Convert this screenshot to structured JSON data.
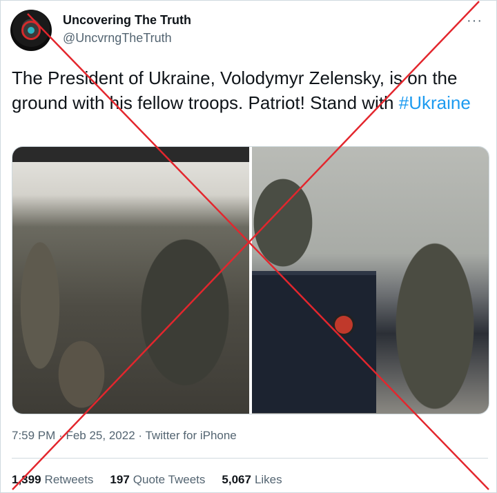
{
  "tweet": {
    "display_name": "Uncovering The Truth",
    "handle": "@UncvrngTheTruth",
    "more_label": "···",
    "text": "The President of Ukraine, Volodymyr Zelensky, is on the ground with his fellow troops. Patriot! Stand with ",
    "hashtag": "#Ukraine",
    "time": "7:59 PM",
    "date": "Feb 25, 2022",
    "source": "Twitter for iPhone",
    "separator": "·"
  },
  "stats": {
    "retweets_count": "1,399",
    "retweets_label": "Retweets",
    "quotes_count": "197",
    "quotes_label": "Quote Tweets",
    "likes_count": "5,067",
    "likes_label": "Likes"
  },
  "overlay": {
    "cross_color": "#e3262d"
  },
  "icons": {
    "more": "more-dots-icon",
    "avatar": "avatar-emblem-icon"
  }
}
